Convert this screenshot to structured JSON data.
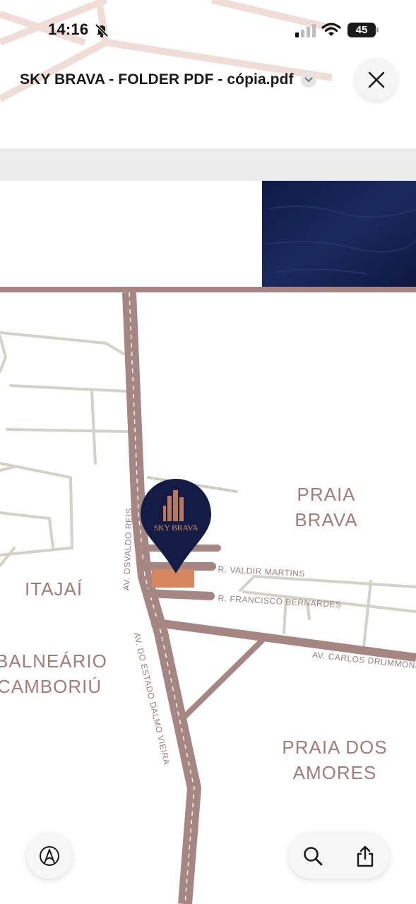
{
  "status_bar": {
    "time": "14:16",
    "battery_level": "45",
    "icons": [
      "bell-slash-icon",
      "cellular-signal-icon",
      "wifi-icon",
      "battery-icon"
    ]
  },
  "header": {
    "document_title": "SKY BRAVA - FOLDER PDF - cópia.pdf",
    "title_menu_icon": "chevron-down-icon",
    "close_icon": "close-icon"
  },
  "map": {
    "areas": {
      "praia_brava_line1": "PRAIA",
      "praia_brava_line2": "BRAVA",
      "itajai": "ITAJAÍ",
      "balneario_line1": "BALNEÁRIO",
      "balneario_line2": "CAMBORIÚ",
      "praia_amores_line1": "PRAIA DOS",
      "praia_amores_line2": "AMORES"
    },
    "streets": {
      "valdir": "R. VALDIR MARTINS",
      "francisco": "R. FRANCISCO BERNARDES",
      "carlos": "AV. CARLOS DRUMMOND",
      "osvaldo": "AV. OSVALDO REIS",
      "dalmo": "AV. DO ESTADO DALMO VIEIRA"
    },
    "pin_brand": "SKY BRAVA",
    "colors": {
      "road_main": "#a68683",
      "road_secondary": "#d4d2c6",
      "label": "#a37c7a",
      "pin": "#141c45",
      "lot": "#d68760",
      "water": "#14204d"
    }
  },
  "toolbar": {
    "markup_icon": "markup-pen-icon",
    "search_icon": "search-icon",
    "share_icon": "share-icon"
  }
}
